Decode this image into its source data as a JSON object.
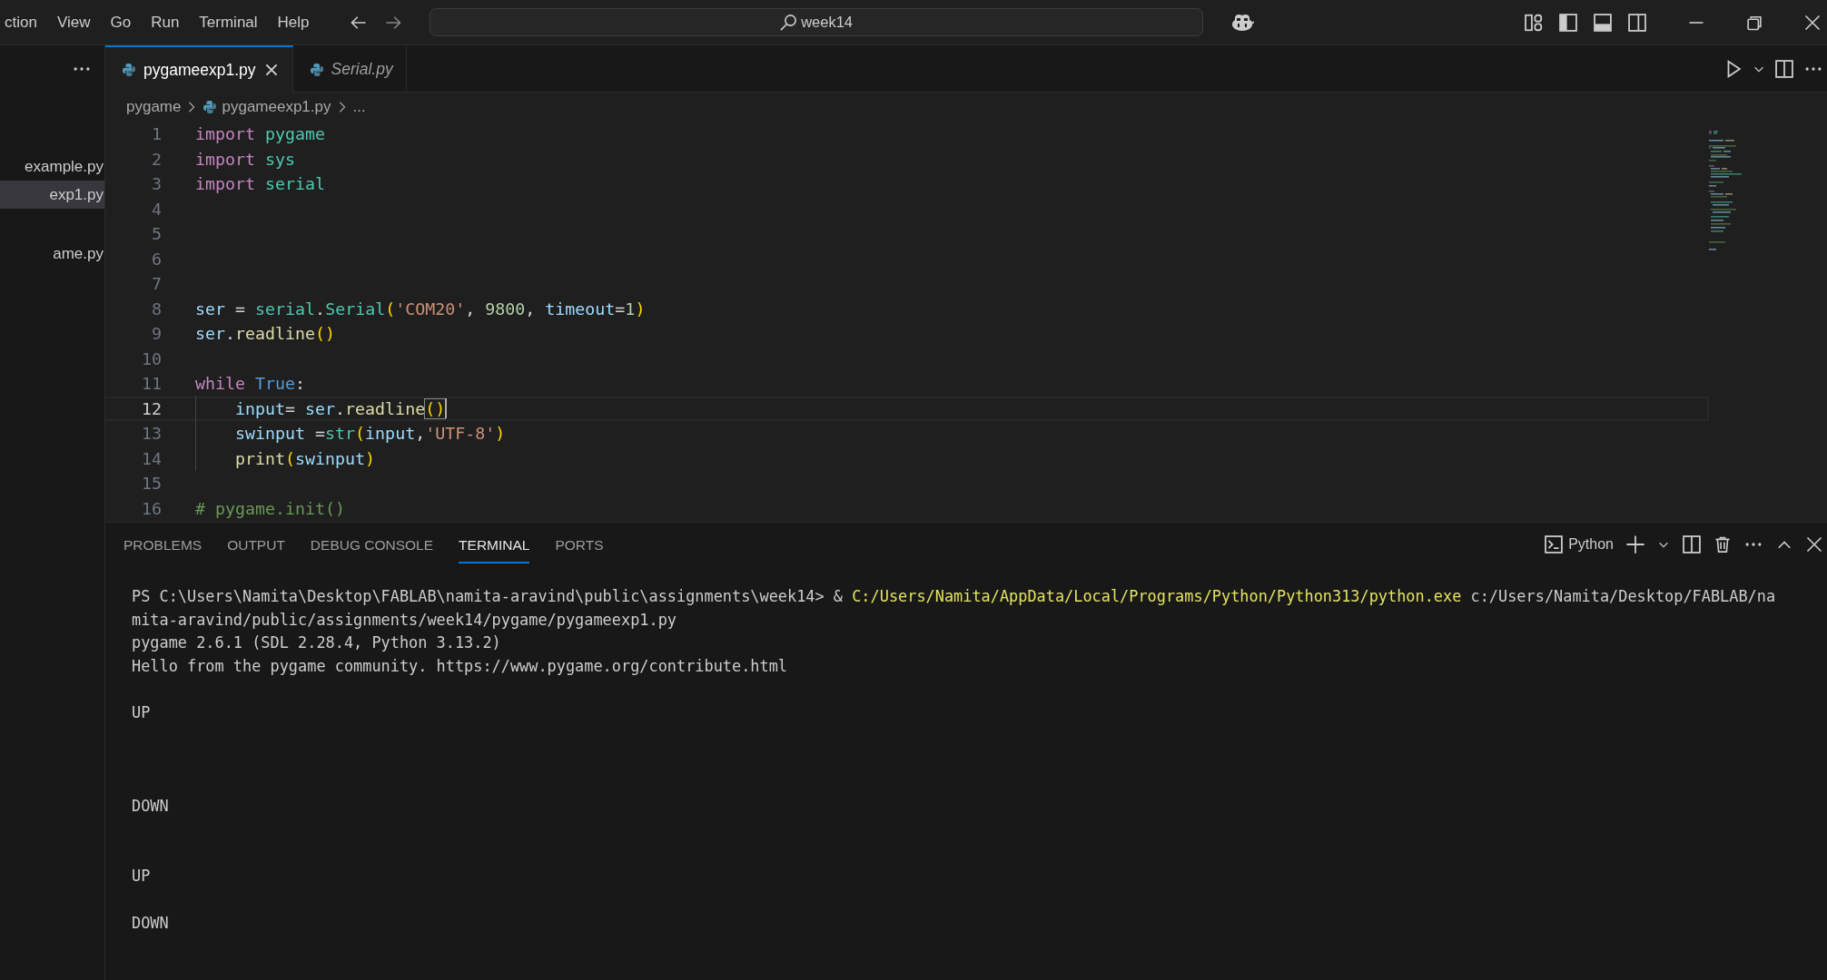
{
  "menu": [
    "ction",
    "View",
    "Go",
    "Run",
    "Terminal",
    "Help"
  ],
  "search": {
    "text": "week14"
  },
  "sidebar": {
    "items": [
      {
        "label": "example.py",
        "selected": false
      },
      {
        "label": "exp1.py",
        "selected": true
      },
      {
        "label": "ame.py",
        "selected": false
      }
    ]
  },
  "tabs": [
    {
      "label": "pygameexp1.py",
      "selected": true,
      "preview": false
    },
    {
      "label": "Serial.py",
      "selected": false,
      "preview": true
    }
  ],
  "breadcrumb": [
    {
      "text": "pygame",
      "kind": "folder"
    },
    {
      "text": "pygameexp1.py",
      "kind": "file"
    },
    {
      "text": "...",
      "kind": "symbol"
    }
  ],
  "code": [
    {
      "number": "1",
      "current": false,
      "tokens": [
        {
          "text": "import ",
          "kind": "keyword"
        },
        {
          "text": "pygame",
          "kind": "module"
        }
      ]
    },
    {
      "number": "2",
      "current": false,
      "tokens": [
        {
          "text": "import ",
          "kind": "keyword"
        },
        {
          "text": "sys",
          "kind": "module"
        }
      ]
    },
    {
      "number": "3",
      "current": false,
      "tokens": [
        {
          "text": "import ",
          "kind": "keyword"
        },
        {
          "text": "serial",
          "kind": "module"
        }
      ]
    },
    {
      "number": "4",
      "current": false
    },
    {
      "number": "5",
      "current": false
    },
    {
      "number": "6",
      "current": false
    },
    {
      "number": "7",
      "current": false
    },
    {
      "number": "8",
      "current": false,
      "tokens": [
        {
          "text": "ser",
          "kind": "variable"
        },
        {
          "text": " = ",
          "kind": "plain"
        },
        {
          "text": "serial",
          "kind": "module"
        },
        {
          "text": ".",
          "kind": "plain"
        },
        {
          "text": "Serial",
          "kind": "module"
        },
        {
          "text": "(",
          "kind": "bracket"
        },
        {
          "text": "'COM20'",
          "kind": "string"
        },
        {
          "text": ", ",
          "kind": "plain"
        },
        {
          "text": "9800",
          "kind": "number"
        },
        {
          "text": ", ",
          "kind": "plain"
        },
        {
          "text": "timeout",
          "kind": "variable"
        },
        {
          "text": "=",
          "kind": "plain"
        },
        {
          "text": "1",
          "kind": "number"
        },
        {
          "text": ")",
          "kind": "bracket"
        }
      ]
    },
    {
      "number": "9",
      "current": false,
      "tokens": [
        {
          "text": "ser",
          "kind": "variable"
        },
        {
          "text": ".",
          "kind": "plain"
        },
        {
          "text": "readline",
          "kind": "function"
        },
        {
          "text": "()",
          "kind": "bracket"
        }
      ]
    },
    {
      "number": "10",
      "current": false
    },
    {
      "number": "11",
      "current": false,
      "tokens": [
        {
          "text": "while ",
          "kind": "keyword"
        },
        {
          "text": "True",
          "kind": "constant"
        },
        {
          "text": ":",
          "kind": "plain"
        }
      ]
    },
    {
      "number": "12",
      "current": true,
      "indent": true,
      "tokens": [
        {
          "text": "input",
          "kind": "variable"
        },
        {
          "text": "= ",
          "kind": "plain"
        },
        {
          "text": "ser",
          "kind": "variable"
        },
        {
          "text": ".",
          "kind": "plain"
        },
        {
          "text": "readline",
          "kind": "function"
        },
        {
          "text": "()",
          "kind": "bracket",
          "matched": true
        }
      ]
    },
    {
      "number": "13",
      "current": false,
      "indent": true,
      "tokens": [
        {
          "text": "swinput",
          "kind": "variable"
        },
        {
          "text": " =",
          "kind": "plain"
        },
        {
          "text": "str",
          "kind": "module"
        },
        {
          "text": "(",
          "kind": "bracket"
        },
        {
          "text": "input",
          "kind": "variable"
        },
        {
          "text": ",",
          "kind": "plain"
        },
        {
          "text": "'UTF-8'",
          "kind": "string"
        },
        {
          "text": ")",
          "kind": "bracket"
        }
      ]
    },
    {
      "number": "14",
      "current": false,
      "indent": true,
      "tokens": [
        {
          "text": "print",
          "kind": "function"
        },
        {
          "text": "(",
          "kind": "bracket"
        },
        {
          "text": "swinput",
          "kind": "variable"
        },
        {
          "text": ")",
          "kind": "bracket"
        }
      ]
    },
    {
      "number": "15",
      "current": false
    },
    {
      "number": "16",
      "current": false,
      "tokens": [
        {
          "text": "# pygame.init()",
          "kind": "comment"
        }
      ]
    }
  ],
  "panel": {
    "tabs": [
      {
        "label": "PROBLEMS",
        "selected": false
      },
      {
        "label": "OUTPUT",
        "selected": false
      },
      {
        "label": "DEBUG CONSOLE",
        "selected": false
      },
      {
        "label": "TERMINAL",
        "selected": true
      },
      {
        "label": "PORTS",
        "selected": false
      }
    ],
    "terminal_name": "Python",
    "terminal_lines": [
      {
        "kind": "output",
        "segments": [
          {
            "text": "PS C:\\Users\\Namita\\Desktop\\FABLAB\\namita-aravind\\public\\assignments\\week14> ",
            "kind": "plain"
          },
          {
            "text": "& ",
            "kind": "plain"
          },
          {
            "text": "C:/Users/Namita/AppData/Local/Programs/Python/Python313/python.exe",
            "kind": "path"
          },
          {
            "text": " c:/Users/Namita/Desktop/FABLAB/na",
            "kind": "plain"
          }
        ]
      },
      {
        "kind": "output",
        "segments": [
          {
            "text": "mita-aravind/public/assignments/week14/pygame/pygameexp1.py",
            "kind": "plain"
          }
        ]
      },
      {
        "kind": "output",
        "segments": [
          {
            "text": "pygame 2.6.1 (SDL 2.28.4, Python 3.13.2)",
            "kind": "plain"
          }
        ]
      },
      {
        "kind": "output",
        "segments": [
          {
            "text": "Hello from the pygame community. https://www.pygame.org/contribute.html",
            "kind": "plain"
          }
        ]
      },
      {
        "kind": "blank"
      },
      {
        "kind": "output",
        "segments": [
          {
            "text": "UP",
            "kind": "plain"
          }
        ]
      },
      {
        "kind": "blank"
      },
      {
        "kind": "blank"
      },
      {
        "kind": "blank"
      },
      {
        "kind": "output",
        "segments": [
          {
            "text": "DOWN",
            "kind": "plain"
          }
        ]
      },
      {
        "kind": "blank"
      },
      {
        "kind": "blank"
      },
      {
        "kind": "output",
        "segments": [
          {
            "text": "UP",
            "kind": "plain"
          }
        ]
      },
      {
        "kind": "blank"
      },
      {
        "kind": "output",
        "segments": [
          {
            "text": "DOWN",
            "kind": "plain"
          }
        ]
      }
    ]
  }
}
